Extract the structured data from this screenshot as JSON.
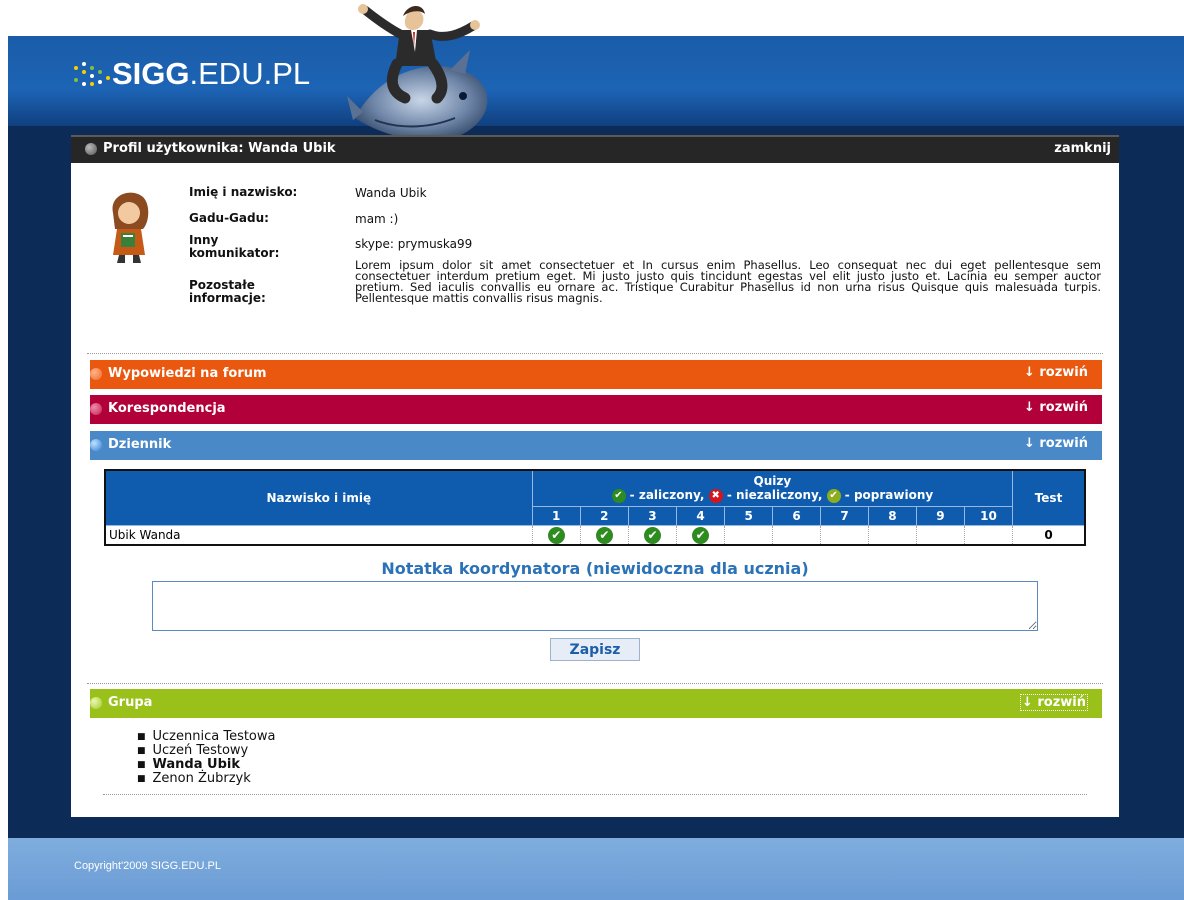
{
  "site": {
    "logo_bold": "SIGG",
    "logo_rest": ".EDU.PL"
  },
  "profile": {
    "title": "Profil użytkownika: Wanda Ubik",
    "close_label": "zamknij",
    "fields": {
      "name_label": "Imię i nazwisko:",
      "name_value": "Wanda Ubik",
      "gg_label": "Gadu-Gadu:",
      "gg_value": "mam :)",
      "other_label": "Inny komunikator:",
      "other_value": "skype: prymuska99",
      "info_label": "Pozostałe informacje:",
      "info_value": "Lorem ipsum dolor sit amet consectetuer et In cursus enim Phasellus. Leo consequat nec dui eget pellentesque sem consectetuer interdum pretium eget. Mi justo justo quis tincidunt egestas vel elit justo justo et. Lacinia eu semper auctor pretium. Sed iaculis convallis eu ornare ac. Tristique Curabitur Phasellus id non urna risus Quisque quis malesuada turpis. Pellentesque mattis convallis risus magnis."
    }
  },
  "sections": {
    "forum": {
      "title": "Wypowiedzi na forum",
      "expand": "↓ rozwiń"
    },
    "correspondence": {
      "title": "Korespondencja",
      "expand": "↓ rozwiń"
    },
    "diary": {
      "title": "Dziennik",
      "expand": "↓ rozwiń"
    },
    "group": {
      "title": "Grupa",
      "expand": "↓ rozwiń"
    }
  },
  "grades": {
    "col_name": "Nazwisko i imię",
    "quiz_header": "Quizy",
    "legend_passed": " - zaliczony, ",
    "legend_failed": " - niezaliczony, ",
    "legend_corrected": " - poprawiony",
    "col_test": "Test",
    "quiz_numbers": [
      "1",
      "2",
      "3",
      "4",
      "5",
      "6",
      "7",
      "8",
      "9",
      "10"
    ],
    "rows": [
      {
        "name": "Ubik Wanda",
        "quizzes": [
          "passed",
          "passed",
          "passed",
          "passed",
          "",
          "",
          "",
          "",
          "",
          ""
        ],
        "test": "0"
      }
    ]
  },
  "note": {
    "title": "Notatka koordynatora (niewidoczna dla ucznia)",
    "save_label": "Zapisz",
    "value": ""
  },
  "group_members": [
    {
      "name": "Uczennica Testowa",
      "current": false
    },
    {
      "name": "Uczeń Testowy",
      "current": false
    },
    {
      "name": "Wanda Ubik",
      "current": true
    },
    {
      "name": "Zenon Żubrzyk",
      "current": false
    }
  ],
  "footer": {
    "copyright": "Copyright'2009 SIGG.EDU.PL"
  },
  "colors": {
    "forum": "#e9580e",
    "correspondence": "#b1003a",
    "diary": "#4a89c8",
    "group": "#99c11a",
    "table_header": "#0f5caf",
    "passed": "#2e8b1f",
    "failed": "#d4141e",
    "corrected": "#8cae1e"
  }
}
